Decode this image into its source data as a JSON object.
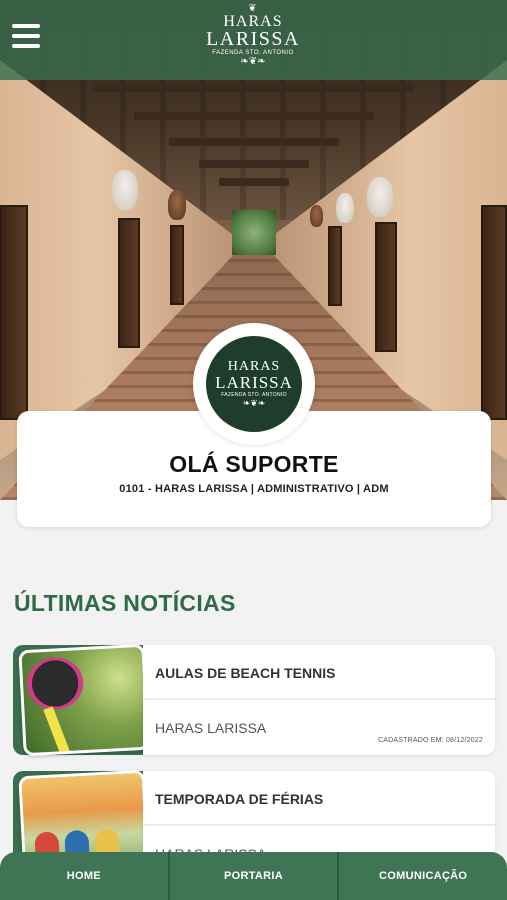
{
  "header": {
    "menu_icon": "hamburger-menu-icon",
    "brand": {
      "crown": "❦",
      "line1": "HARAS",
      "line2": "LARISSA",
      "line3": "FAZENDA STO. ANTONIO",
      "ornament": "❧❦❧"
    }
  },
  "profile": {
    "avatar": {
      "line1": "HARAS",
      "line2": "LARISSA",
      "line3": "FAZENDA STO. ANTONIO",
      "ornament": "❧❦❧"
    },
    "greeting": "OLÁ SUPORTE",
    "details": "0101 - HARAS LARISSA | ADMINISTRATIVO | ADM"
  },
  "news": {
    "section_title": "ÚLTIMAS NOTÍCIAS",
    "items": [
      {
        "title": "AULAS DE BEACH TENNIS",
        "source": "HARAS LARISSA",
        "date": "CADASTRADO EM: 08/12/2022"
      },
      {
        "title": "TEMPORADA DE FÉRIAS",
        "source": "HARAS LARISSA",
        "date": ""
      }
    ]
  },
  "bottom_nav": {
    "items": [
      {
        "label": "HOME"
      },
      {
        "label": "PORTARIA"
      },
      {
        "label": "COMUNICAÇÃO"
      }
    ]
  },
  "colors": {
    "primary_green": "#3f7555",
    "title_green": "#2f6b45",
    "avatar_bg": "#1f3d2c"
  }
}
